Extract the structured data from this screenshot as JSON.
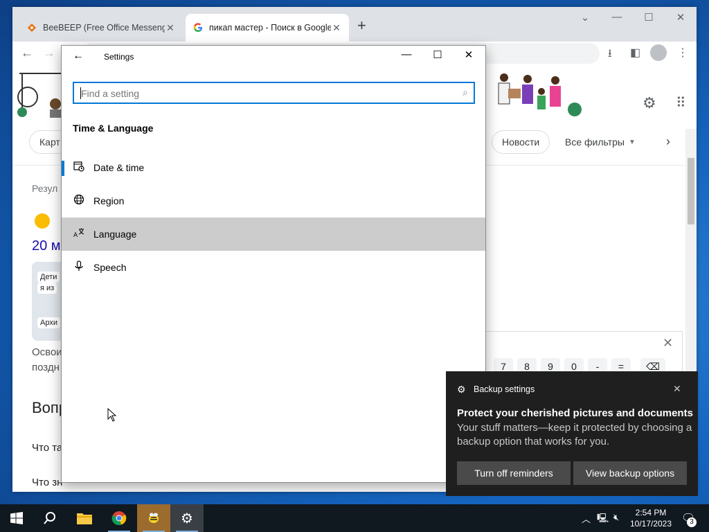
{
  "browser": {
    "tabs": [
      {
        "title": "BeeBEEP (Free Office Messenger)",
        "favicon": "beebeep-icon",
        "close": "✕"
      },
      {
        "title": "пикап мастер - Поиск в Google",
        "favicon": "google-icon",
        "close": "✕"
      }
    ],
    "new_tab": "+",
    "page": {
      "chip_left": "Карт",
      "chip_news": "Новости",
      "chip_filters": "Все фильтры",
      "results_prefix": "Резул",
      "result_date": "20 м",
      "card_line1": "Дети",
      "card_line2": "я из",
      "card_line3": "Архи",
      "snippet1": "Освои",
      "snippet2": "поздн",
      "questions_heading": "Вопр",
      "question1": "Что та",
      "question2": "Что зн",
      "calc_keys": [
        "7",
        "8",
        "9",
        "0",
        "-",
        "=",
        "⌫"
      ]
    }
  },
  "settings": {
    "title": "Settings",
    "search_placeholder": "Find a setting",
    "section": "Time & Language",
    "items": [
      {
        "label": "Date & time",
        "icon": "calendar-clock-icon"
      },
      {
        "label": "Region",
        "icon": "globe-icon"
      },
      {
        "label": "Language",
        "icon": "language-icon"
      },
      {
        "label": "Speech",
        "icon": "microphone-icon"
      }
    ]
  },
  "toast": {
    "app": "Backup settings",
    "heading": "Protect your cherished pictures and documents",
    "body": "Your stuff matters—keep it protected by choosing a backup option that works for you.",
    "button1": "Turn off reminders",
    "button2": "View backup options"
  },
  "taskbar": {
    "time": "2:54 PM",
    "date": "10/17/2023",
    "notification_count": "3",
    "apps": [
      "start-icon",
      "search-icon",
      "file-explorer-icon",
      "chrome-icon",
      "beebeep-icon",
      "settings-icon"
    ]
  }
}
